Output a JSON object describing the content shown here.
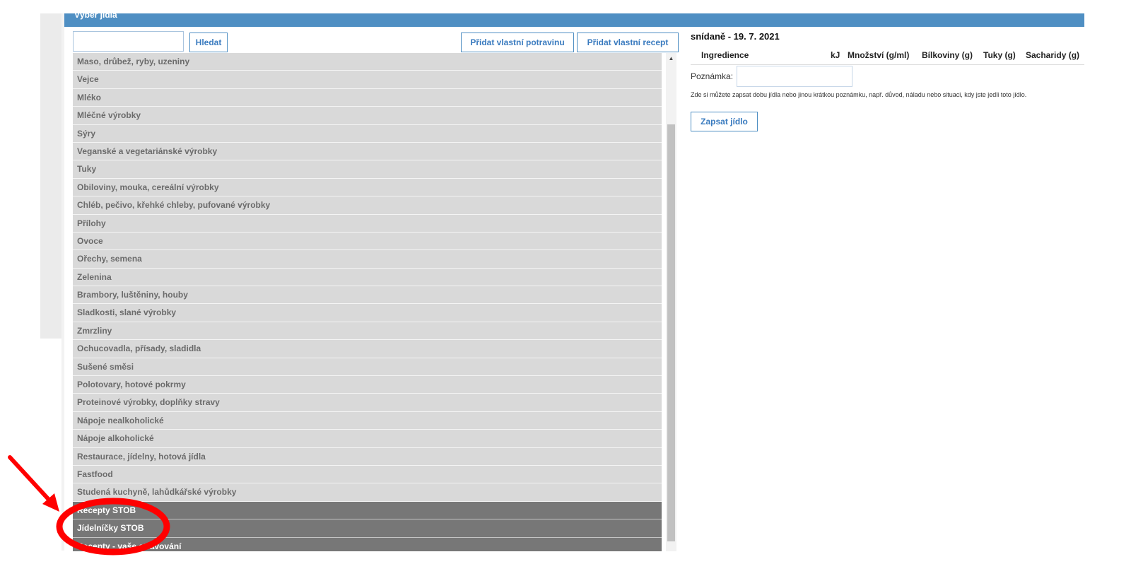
{
  "panel": {
    "header_title": "Výběr jídla"
  },
  "search": {
    "value": "",
    "placeholder": "",
    "button_label": "Hledat"
  },
  "toolbar": {
    "add_food_label": "Přidat vlastní potravinu",
    "add_recipe_label": "Přidat vlastní recept"
  },
  "categories": [
    "Maso, drůbež, ryby, uzeniny",
    "Vejce",
    "Mléko",
    "Mléčné výrobky",
    "Sýry",
    "Veganské a vegetariánské výrobky",
    "Tuky",
    "Obiloviny, mouka, cereální výrobky",
    "Chléb, pečivo, křehké chleby, pufované výrobky",
    "Přílohy",
    "Ovoce",
    "Ořechy, semena",
    "Zelenina",
    "Brambory, luštěniny, houby",
    "Sladkosti, slané výrobky",
    "Zmrzliny",
    "Ochucovadla, přísady, sladidla",
    "Sušené směsi",
    "Polotovary, hotové pokrmy",
    "Proteinové výrobky, doplňky stravy",
    "Nápoje nealkoholické",
    "Nápoje alkoholické",
    "Restaurace, jídelny, hotová jídla",
    "Fastfood",
    "Studená kuchyně, lahůdkářské výrobky"
  ],
  "special_categories": [
    "Recepty STOB",
    "Jídelníčky STOB",
    "Recepty - vaše stravování"
  ],
  "meal": {
    "title": "snídaně - 19. 7. 2021",
    "columns": {
      "ingredience": "Ingredience",
      "kj": "kJ",
      "mnozstvi": "Množství (g/ml)",
      "bilkoviny": "Bílkoviny (g)",
      "tuky": "Tuky (g)",
      "sacharidy": "Sacharidy (g)"
    },
    "note_label": "Poznámka:",
    "note_value": "",
    "note_help": "Zde si můžete zapsat dobu jídla nebo jinou krátkou poznámku, např. důvod, náladu nebo situaci, kdy jste jedli toto jídlo.",
    "save_label": "Zapsat jídlo"
  },
  "annotation": {
    "color": "#ff0000"
  }
}
